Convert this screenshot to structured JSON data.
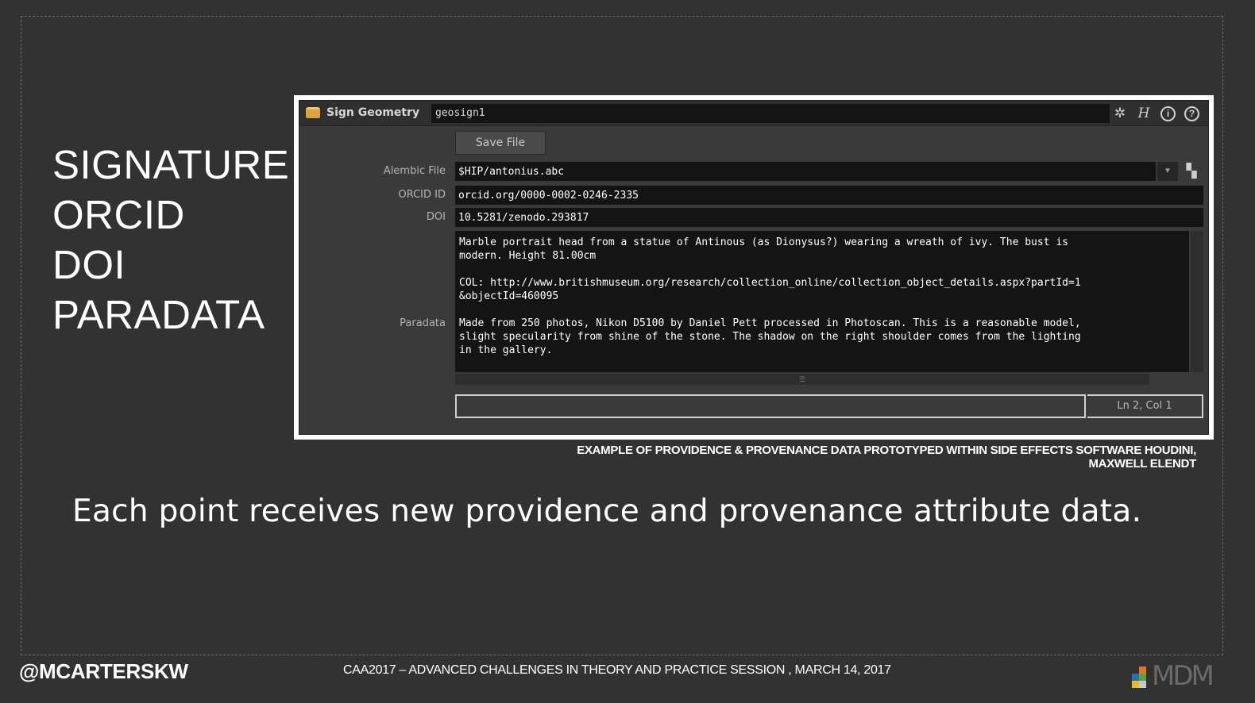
{
  "keywords": [
    "SIGNATURE",
    "ORCID",
    "DOI",
    "PARADATA"
  ],
  "panel": {
    "node_type": "Sign Geometry",
    "node_name": "geosign1",
    "save_label": "Save File",
    "alembic_label": "Alembic File",
    "alembic_value": "$HIP/antonius.abc",
    "orcid_label": "ORCID ID",
    "orcid_value": "orcid.org/0000-0002-0246-2335",
    "doi_label": "DOI",
    "doi_value": "10.5281/zenodo.293817",
    "paradata_label": "Paradata",
    "paradata_value": "Marble portrait head from a statue of Antinous (as Dionysus?) wearing a wreath of ivy. The bust is\nmodern. Height 81.00cm\n\nCOL: http://www.britishmuseum.org/research/collection_online/collection_object_details.aspx?partId=1\n&objectId=460095\n\nMade from 250 photos, Nikon D5100 by Daniel Pett processed in Photoscan. This is a reasonable model,\nslight specularity from shine of the stone. The shadow on the right shoulder comes from the lighting\nin the gallery.",
    "cursor_position": "Ln 2, Col 1",
    "icons": [
      "gear-icon",
      "help-h-icon",
      "info-icon",
      "question-icon",
      "file-chooser-icon",
      "dropdown-icon"
    ]
  },
  "caption": {
    "line1": "EXAMPLE OF PROVIDENCE & PROVENANCE DATA PROTOTYPED WITHIN SIDE EFFECTS SOFTWARE HOUDINI,",
    "line2": "MAXWELL ELENDT"
  },
  "statement": "Each point receives new providence and provenance attribute data.",
  "footer": {
    "handle": "@MCARTERSKW",
    "session": "CAA2017 – ADVANCED CHALLENGES IN THEORY AND PRACTICE SESSION , MARCH 14, 2017",
    "logo_text": "MDM"
  },
  "colors": {
    "background": "#323232",
    "panel_bg": "#3a3a3a",
    "field_bg": "#141414",
    "logo_orange": "#e8742a",
    "logo_blue": "#2a6fb5",
    "logo_green": "#5aa33a",
    "logo_yellow": "#e8b92a"
  }
}
